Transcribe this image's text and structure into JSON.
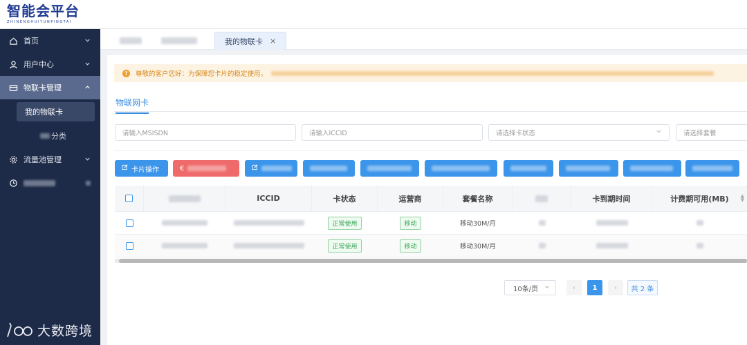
{
  "app": {
    "logo_text": "智能会平台",
    "logo_subtitle": "ZHINENGHUIYUNPINGTAI",
    "watermark_text": "大数跨境"
  },
  "sidebar": {
    "items": [
      {
        "label": "首页",
        "icon": "home-icon"
      },
      {
        "label": "用户中心",
        "icon": "user-icon"
      },
      {
        "label": "物联卡管理",
        "icon": "card-icon"
      },
      {
        "label": "流量池管理",
        "icon": "gear-icon"
      }
    ],
    "sub_items": [
      {
        "label": "我的物联卡"
      },
      {
        "label": "分类"
      }
    ]
  },
  "tabs": {
    "active_label": "我的物联卡",
    "close_glyph": "×"
  },
  "notice": {
    "text": "尊敬的客户您好：为保障您卡片的稳定使用，"
  },
  "subtab": {
    "label": "物联网卡"
  },
  "filters": {
    "msisdn_placeholder": "请输入MSISDN",
    "iccid_placeholder": "请输入ICCID",
    "status_placeholder": "请选择卡状态",
    "plan_placeholder": "请选择套餐"
  },
  "toolbar": {
    "card_op_label": "卡片操作"
  },
  "table": {
    "headers": {
      "iccid": "ICCID",
      "status": "卡状态",
      "operator": "运营商",
      "plan": "套餐名称",
      "expire": "卡到期时间",
      "billing": "计费期可用(MB)"
    },
    "rows": [
      {
        "status": "正常使用",
        "operator": "移动",
        "plan": "移动30M/月"
      },
      {
        "status": "正常使用",
        "operator": "移动",
        "plan": "移动30M/月"
      }
    ]
  },
  "pagination": {
    "page_size": "10条/页",
    "current_page": "1",
    "total": "共 2 条",
    "prev_glyph": "‹",
    "next_glyph": "›"
  },
  "colors": {
    "sidebar_bg": "#1d2a48",
    "primary": "#3b95ea",
    "danger": "#ef6b6b",
    "warning_text": "#d98a1e",
    "success_tag": "#3da85a"
  }
}
